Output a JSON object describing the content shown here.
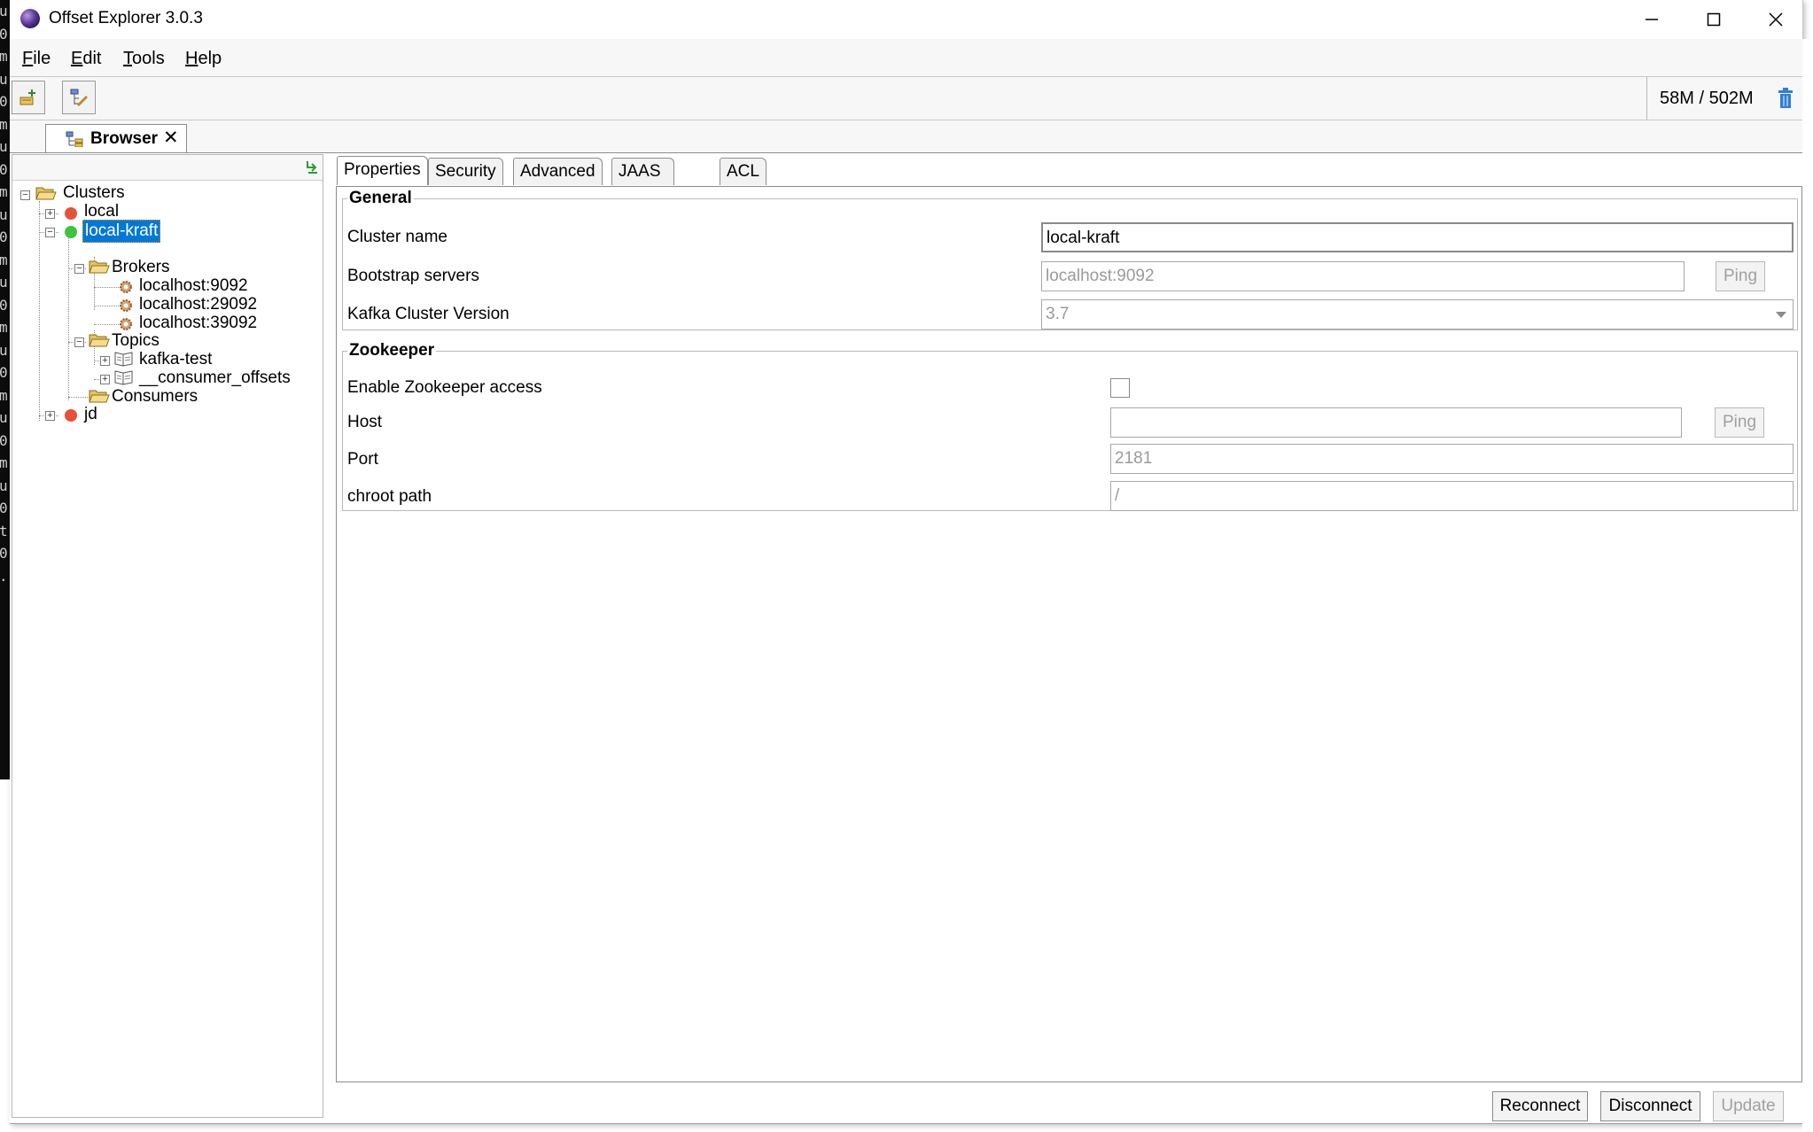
{
  "window": {
    "title": "Offset Explorer  3.0.3"
  },
  "background_strip": [
    "u",
    "0",
    "m",
    "u",
    "0",
    "m",
    "u",
    "0",
    "m",
    "u",
    "0",
    "m",
    "u",
    "0",
    "m",
    "u",
    "0",
    "m",
    "u",
    "0",
    "m",
    "u",
    "0",
    "t",
    "0",
    "."
  ],
  "menu": {
    "file": {
      "mnemonic": "F",
      "rest": "ile"
    },
    "edit": {
      "mnemonic": "E",
      "rest": "dit"
    },
    "tools": {
      "mnemonic": "T",
      "rest": "ools"
    },
    "help": {
      "mnemonic": "H",
      "rest": "elp"
    }
  },
  "toolbar": {
    "memory": "58M / 502M"
  },
  "doc_tab": {
    "label": "Browser",
    "close": "✕"
  },
  "tree": {
    "root": "Clusters",
    "clusters": [
      {
        "label": "local",
        "status_color": "#e8503a"
      },
      {
        "label": "local-kraft",
        "status_color": "#3cc43c"
      },
      {
        "label": "jd",
        "status_color": "#e8503a"
      }
    ],
    "brokers_label": "Brokers",
    "brokers": [
      "localhost:9092",
      "localhost:29092",
      "localhost:39092"
    ],
    "topics_label": "Topics",
    "topics": [
      "kafka-test",
      "__consumer_offsets"
    ],
    "consumers_label": "Consumers"
  },
  "tabs": [
    "Properties",
    "Security",
    "Advanced",
    "JAAS Config",
    "ACL"
  ],
  "general": {
    "legend": "General",
    "cluster_name_label": "Cluster name",
    "cluster_name_value": "local-kraft",
    "bootstrap_label": "Bootstrap servers",
    "bootstrap_value": "localhost:9092",
    "ping_label": "Ping",
    "version_label": "Kafka Cluster Version",
    "version_value": "3.7"
  },
  "zookeeper": {
    "legend": "Zookeeper",
    "enable_label": "Enable Zookeeper access",
    "host_label": "Host",
    "host_value": "",
    "ping_label": "Ping",
    "port_label": "Port",
    "port_value": "2181",
    "chroot_label": "chroot path",
    "chroot_value": "/"
  },
  "actions": {
    "reconnect": "Reconnect",
    "disconnect": "Disconnect",
    "update": "Update"
  },
  "colors": {
    "selection": "#0078d7",
    "folder": "#e8c35a"
  }
}
